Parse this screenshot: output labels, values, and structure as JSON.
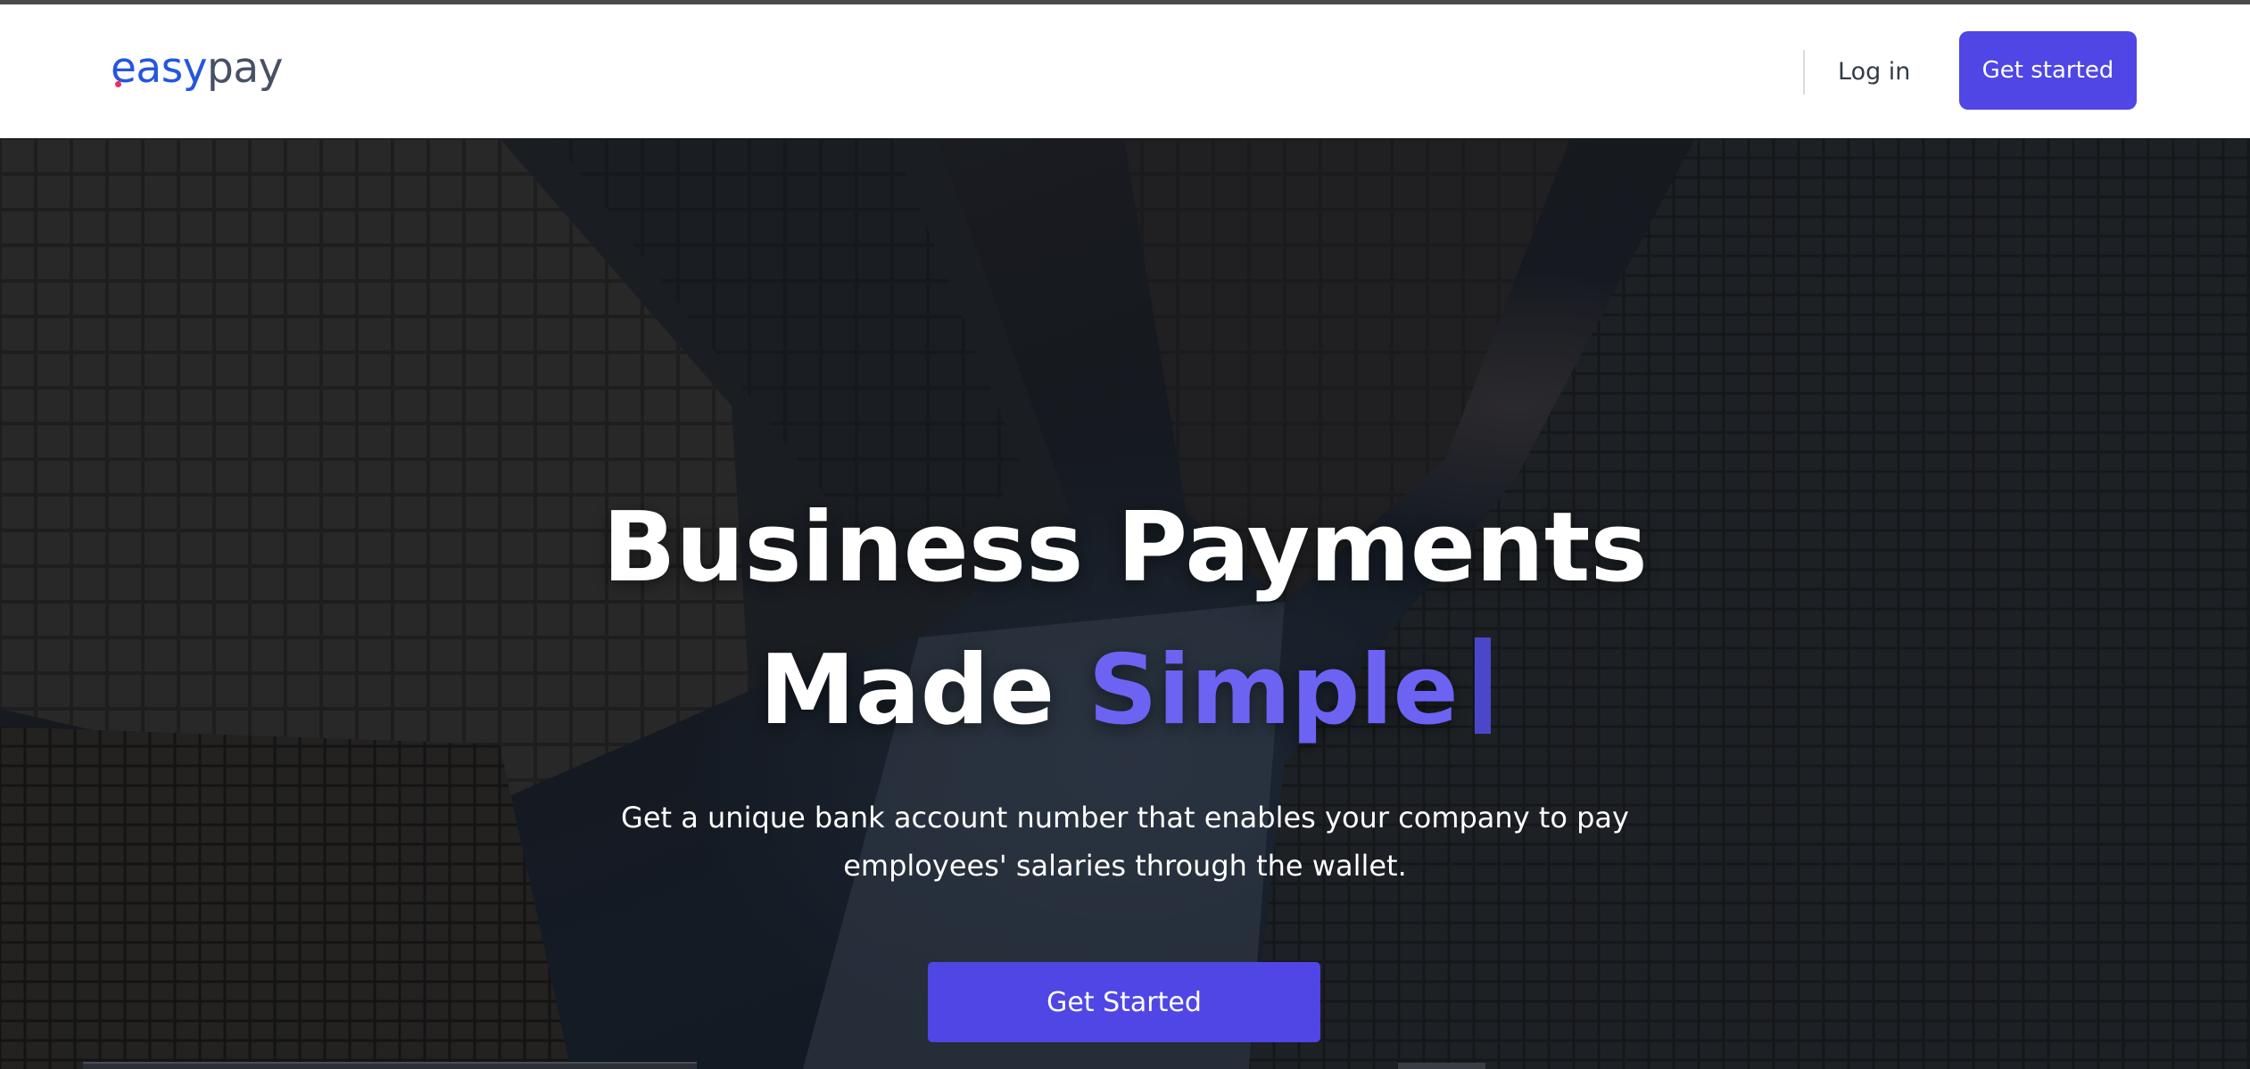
{
  "brand": {
    "logo_part_a": "easy",
    "logo_part_b": "pay",
    "colors": {
      "primary": "#4f46e5",
      "logo_blue": "#2456e0",
      "logo_gray": "#475065",
      "logo_dot": "#ef2f5e"
    }
  },
  "header": {
    "login_label": "Log in",
    "cta_label": "Get started"
  },
  "hero": {
    "headline_line1": "Business Payments",
    "headline_line2_plain": "Made ",
    "headline_line2_accent": "Simple",
    "subtext": "Get a unique bank account number that enables your company to pay employees' salaries through the wallet.",
    "cta_label": "Get Started",
    "background_image": "city-skyscrapers-looking-up-photo"
  }
}
